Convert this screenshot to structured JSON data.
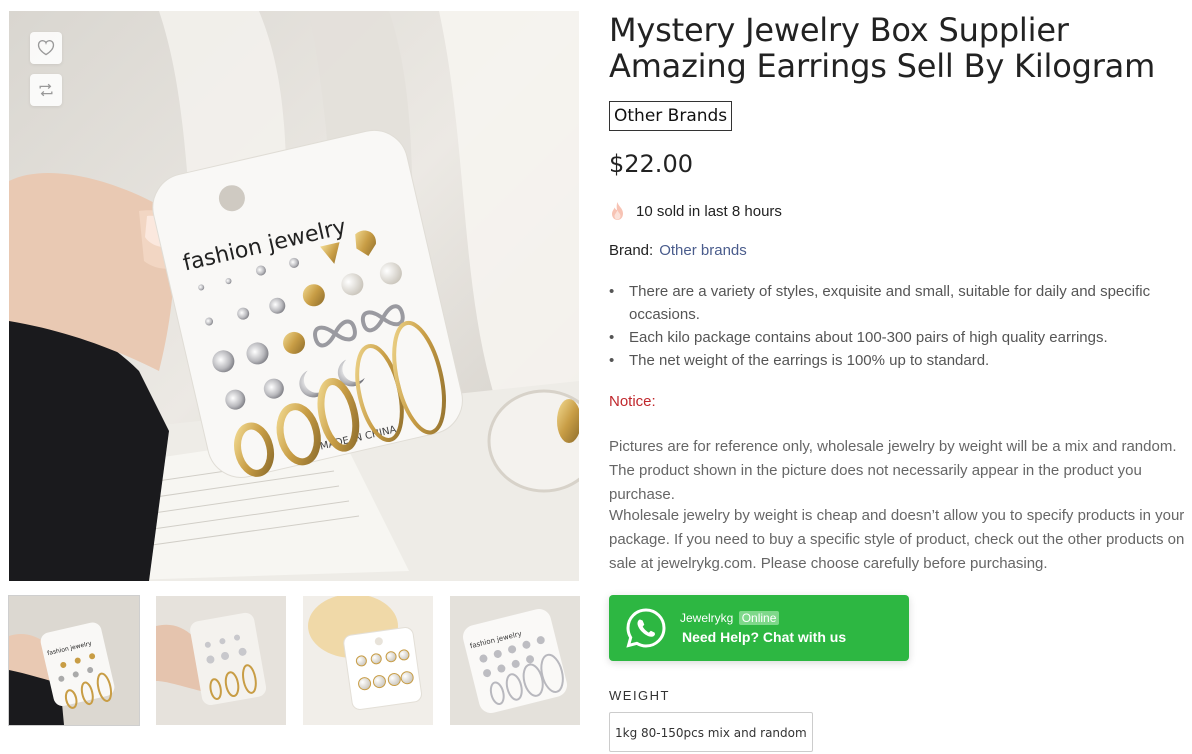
{
  "product": {
    "title": "Mystery Jewelry Box Supplier Amazing Earrings Sell By Kilogram",
    "brand_tag": "Other Brands",
    "price": "$22.00",
    "sold_text": "10 sold in last 8 hours",
    "brand_label": "Brand:",
    "brand_value": "Other brands",
    "features": [
      "There are a variety of styles, exquisite and small, suitable for daily and specific occasions.",
      "Each kilo package contains about 100-300 pairs of high quality earrings.",
      "The net weight of the earrings is 100% up to standard."
    ],
    "notice_label": "Notice:",
    "notice_paragraphs": [
      "Pictures are for reference only, wholesale jewelry by weight will be a mix and random. The product shown in the picture does not necessarily appear in the product you purchase.",
      "Wholesale jewelry by weight is cheap and doesn’t allow you to specify products in your package. If you need to buy a specific style of product, check out the other products on sale at jewelrykg.com. Please choose carefully before purchasing."
    ]
  },
  "gallery": {
    "main_card_text": "fashion jewelry",
    "card_bottom_text": "MADE IN CHINA",
    "thumb_card_text": "fashion jewelry",
    "thumbnail_count": 4,
    "icons": [
      "heart-icon",
      "compare-icon"
    ]
  },
  "chat": {
    "agent_name": "Jewelrykg",
    "status": "Online",
    "cta": "Need Help? Chat with us",
    "icon": "whatsapp-icon",
    "color": "#2db742"
  },
  "options": {
    "weight_label": "WEIGHT",
    "weight_selected": "1kg 80-150pcs mix and random"
  },
  "colors": {
    "notice": "#c0282d",
    "brand_link": "#4a5c8c"
  }
}
